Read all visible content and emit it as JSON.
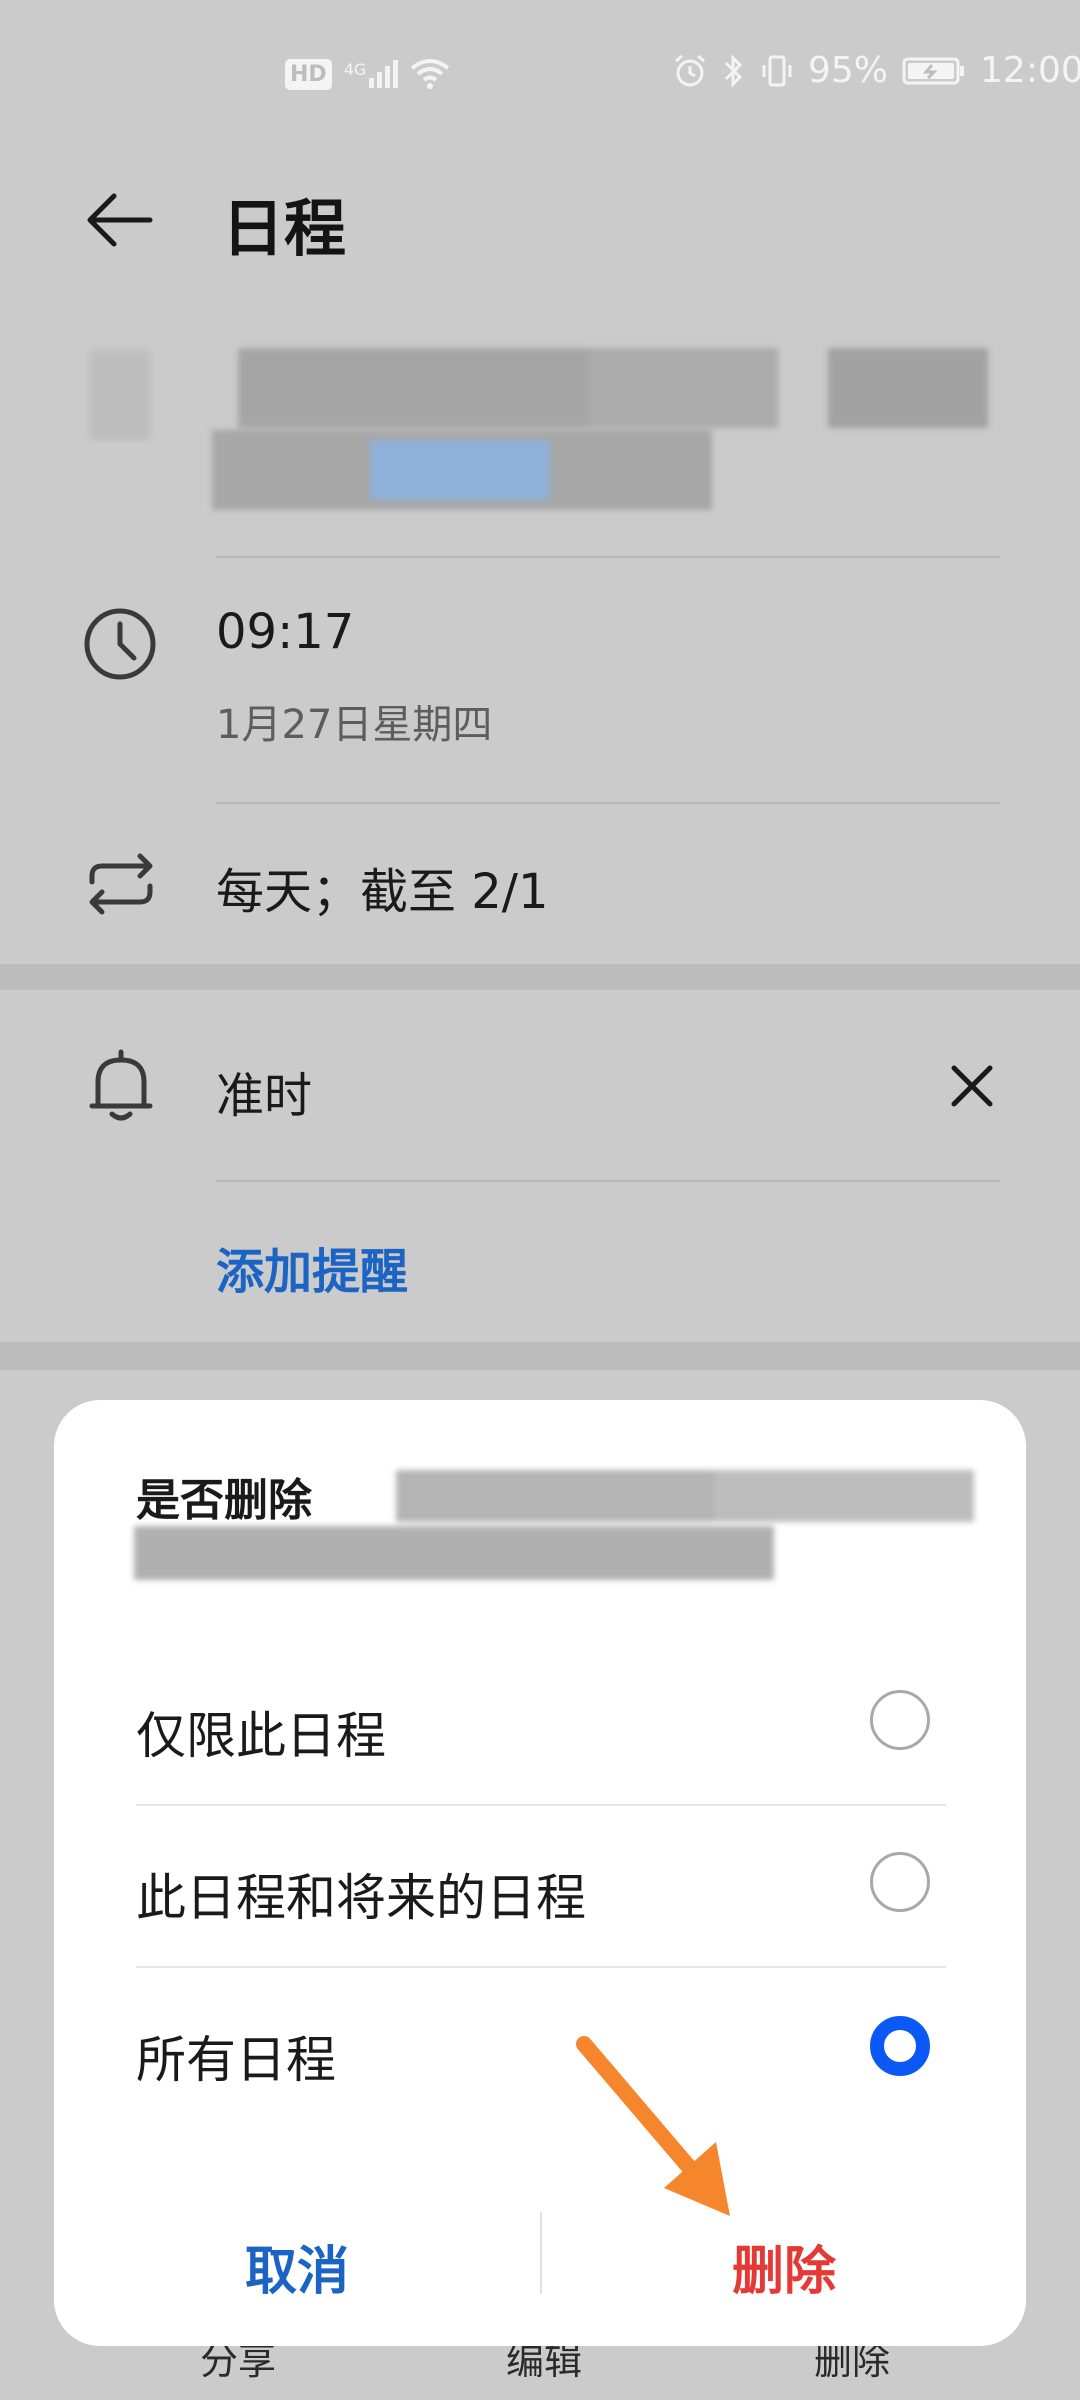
{
  "status_bar": {
    "left_badges": [
      "HD",
      "4G"
    ],
    "battery": "95%",
    "time": "12:00"
  },
  "header": {
    "title": "日程"
  },
  "event": {
    "time": "09:17",
    "date": "1月27日星期四",
    "repeat": "每天；截至 2/1",
    "reminder": "准时",
    "add_reminder": "添加提醒"
  },
  "dialog": {
    "title_prefix": "是否删除",
    "options": [
      {
        "label": "仅限此日程",
        "selected": false
      },
      {
        "label": "此日程和将来的日程",
        "selected": false
      },
      {
        "label": "所有日程",
        "selected": true
      }
    ],
    "cancel_label": "取消",
    "delete_label": "删除"
  },
  "bottom_bar": {
    "share": "分享",
    "edit": "编辑",
    "delete": "删除"
  },
  "colors": {
    "accent_blue": "#0a59f7",
    "link_blue": "#1c64c4",
    "danger_red": "#e53935",
    "annotation_arrow": "#f5862b"
  }
}
